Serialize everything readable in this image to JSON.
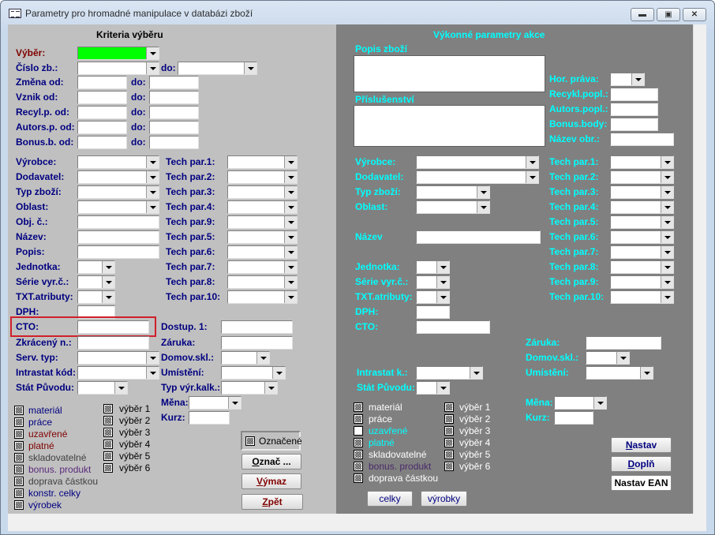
{
  "window": {
    "title": "Parametry pro hromadné manipulace v databázi zboží",
    "icon": "form-icon",
    "controls": [
      "minimize",
      "maximize",
      "close"
    ]
  },
  "colors": {
    "left_panel": "#c0c0c0",
    "right_panel": "#808080",
    "left_label": "#000080",
    "right_label": "#00ffff",
    "highlight": "#00ff00",
    "alert": "#800000"
  },
  "left": {
    "title": "Kriteria výběru",
    "vyber": "Výběr:",
    "cislo": "Číslo zb.:",
    "do": "do:",
    "zmena": "Změna od:",
    "vznik": "Vznik od:",
    "recyl": "Recyl.p. od:",
    "autors": "Autors.p. od:",
    "bonus": "Bonus.b. od:",
    "vyrobce": "Výrobce:",
    "dodavatel": "Dodavatel:",
    "typ": "Typ zboží:",
    "oblast": "Oblast:",
    "obj": "Obj. č.:",
    "nazev": "Název:",
    "popis": "Popis:",
    "jednotka": "Jednotka:",
    "serie": "Série vyr.č.:",
    "txt": "TXT.atributy:",
    "dph": "DPH:",
    "cto": "CTO:",
    "zkraceny": "Zkrácený n.:",
    "serv": "Serv. typ:",
    "intrastat": "Intrastat kód:",
    "stat": "Stát Původu:",
    "tech": [
      "Tech par.1:",
      "Tech par.2:",
      "Tech par.3:",
      "Tech par.4:",
      "Tech par.9:",
      "Tech par.5:",
      "Tech par.6:",
      "Tech par.7:",
      "Tech par.8:",
      "Tech par.10:"
    ],
    "dostup": "Dostup. 1:",
    "zaruka": "Záruka:",
    "domov": "Domov.skl.:",
    "umisteni": "Umístění:",
    "typvyr": "Typ výr.kalk.:",
    "mena": "Měna:",
    "kurz": "Kurz:",
    "checks": [
      {
        "label": "materiál",
        "checked": true,
        "color": "#000080"
      },
      {
        "label": "práce",
        "checked": true,
        "color": "#000080"
      },
      {
        "label": "uzavřené",
        "checked": true,
        "color": "#800000"
      },
      {
        "label": "platné",
        "checked": true,
        "color": "#800000"
      },
      {
        "label": "skladovatelné",
        "checked": true,
        "color": "#404040"
      },
      {
        "label": "bonus. produkt",
        "checked": true,
        "color": "#5a2a7a"
      },
      {
        "label": "doprava částkou",
        "checked": true,
        "color": "#404040"
      },
      {
        "label": "konstr. celky",
        "checked": true,
        "color": "#000080"
      },
      {
        "label": "výrobek",
        "checked": true,
        "color": "#000080"
      }
    ],
    "vybery": [
      {
        "label": "výběr 1",
        "checked": true
      },
      {
        "label": "výběr 2",
        "checked": true
      },
      {
        "label": "výběr 3",
        "checked": true
      },
      {
        "label": "výběr 4",
        "checked": true
      },
      {
        "label": "výběr 5",
        "checked": true
      },
      {
        "label": "výběr 6",
        "checked": true
      }
    ],
    "oznacene": {
      "label": "Označené",
      "checked": true
    },
    "buttons": {
      "oznac": "Označ ...",
      "vymaz": "Výmaz",
      "zpet": "Zpět"
    }
  },
  "right": {
    "title": "Výkonné parametry akce",
    "popis": "Popis zboží",
    "prislusenstvi": "Příslušenství",
    "hor": "Hor. práva:",
    "recykl": "Recykl.popl.:",
    "autors": "Autors.popl.:",
    "bonus": "Bonus.body:",
    "nazevobr": "Název obr.:",
    "vyrobce": "Výrobce:",
    "dodavatel": "Dodavatel:",
    "typ": "Typ zboží:",
    "oblast": "Oblast:",
    "nazev": "Název",
    "jednotka": "Jednotka:",
    "serie": "Série vyr.č.:",
    "txt": "TXT.atributy:",
    "dph": "DPH:",
    "cto": "CTO:",
    "intrastat": "Intrastat k.:",
    "stat": "Stát Původu:",
    "tech": [
      "Tech par.1:",
      "Tech par.2:",
      "Tech par.3:",
      "Tech par.4:",
      "Tech par.5:",
      "Tech par.6:",
      "Tech par.7:",
      "Tech par.8:",
      "Tech par.9:",
      "Tech par.10:"
    ],
    "zaruka": "Záruka:",
    "domov": "Domov.skl.:",
    "umisteni": "Umístění:",
    "mena": "Měna:",
    "kurz": "Kurz:",
    "checks": [
      {
        "label": "materiál",
        "checked": true,
        "color": "#ffffff"
      },
      {
        "label": "práce",
        "checked": true,
        "color": "#ffffff"
      },
      {
        "label": "uzavřené",
        "checked": false,
        "color": "#00ffff"
      },
      {
        "label": "platné",
        "checked": true,
        "color": "#00ffff"
      },
      {
        "label": "skladovatelné",
        "checked": true,
        "color": "#ffffff"
      },
      {
        "label": "bonus. produkt",
        "checked": true,
        "color": "#4a2a6a"
      },
      {
        "label": "doprava částkou",
        "checked": true,
        "color": "#ffffff"
      }
    ],
    "vybery": [
      {
        "label": "výběr 1",
        "checked": true
      },
      {
        "label": "výběr 2",
        "checked": true
      },
      {
        "label": "výběr 3",
        "checked": true
      },
      {
        "label": "výběr 4",
        "checked": true
      },
      {
        "label": "výběr 5",
        "checked": true
      },
      {
        "label": "výběr 6",
        "checked": true
      }
    ],
    "buttons": {
      "celky": "celky",
      "vyrobky": "výrobky",
      "nastav": "Nastav",
      "dopln": "Doplň",
      "nastav_ean": "Nastav EAN"
    }
  }
}
